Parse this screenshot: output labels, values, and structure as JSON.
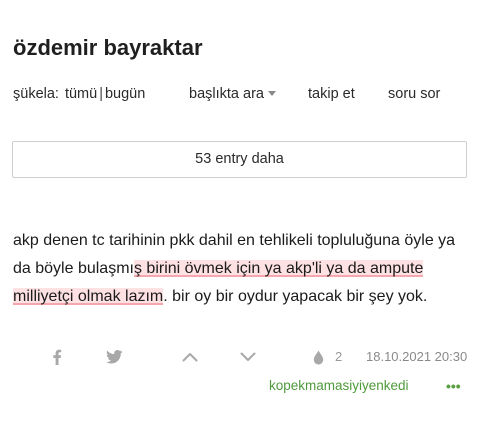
{
  "topic": {
    "title": "özdemir bayraktar"
  },
  "nav": {
    "sukela_label": "şükela:",
    "all_label": "tümü",
    "separator": "|",
    "today_label": "bugün",
    "search_label": "başlıkta ara",
    "follow_label": "takip et",
    "ask_label": "soru sor"
  },
  "more_button": {
    "label": "53 entry daha"
  },
  "entry": {
    "text_part1": "akp denen tc tarihinin pkk dahil en tehlikeli topluluğuna öyle ya da böyle bulaşmı",
    "highlighted": "ş birini övmek için ya akp'li ya da ampute milliyetçi olmak lazım",
    "text_part2": ". bir oy bir oydur yapacak bir şey yok.",
    "highlight_color": "#fde1e3",
    "fav_count": "2",
    "date": "18.10.2021 20:30",
    "author": "kopekmamasiyiyenkedi",
    "more_dots": "•••"
  },
  "icons": {
    "share_facebook": "facebook-icon",
    "share_twitter": "twitter-icon",
    "upvote": "chevron-up-icon",
    "downvote": "chevron-down-icon",
    "favorite": "drop-icon"
  },
  "colors": {
    "author": "#4f9a3c",
    "icon_gray": "#9a9a9a"
  }
}
